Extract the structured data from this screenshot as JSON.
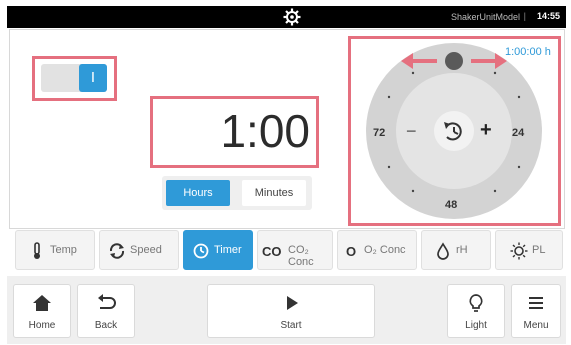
{
  "status_bar": {
    "model": "ShakerUnitModel",
    "separator": "|",
    "clock": "14:55",
    "settings_icon": "gear-icon"
  },
  "controls": {
    "toggle_label": "I",
    "toggle_on": true,
    "time_value": "1:00",
    "units": [
      {
        "label": "Hours",
        "selected": true
      },
      {
        "label": "Minutes",
        "selected": false
      }
    ]
  },
  "dial": {
    "readout": "1:00:00 h",
    "minus_symbol": "−",
    "plus_symbol": "+",
    "labels": {
      "left": "72",
      "right": "24",
      "bottom": "48"
    },
    "center_icon": "timer-reset-icon"
  },
  "tabs": [
    {
      "label": "Temp",
      "icon": "thermometer-icon",
      "active": false
    },
    {
      "label": "Speed",
      "icon": "rotate-icon",
      "active": false
    },
    {
      "label": "Timer",
      "icon": "clock-icon",
      "active": true
    },
    {
      "label": "CO₂ Conc",
      "icon": "co2-icon",
      "active": false
    },
    {
      "label": "O₂ Conc",
      "icon": "o2-icon",
      "active": false
    },
    {
      "label": "rH",
      "icon": "droplet-icon",
      "active": false
    },
    {
      "label": "PL",
      "icon": "sun-icon",
      "active": false
    }
  ],
  "bottom_bar": {
    "home": "Home",
    "back": "Back",
    "start": "Start",
    "light": "Light",
    "menu": "Menu"
  },
  "colors": {
    "accent": "#2f9ad8",
    "highlight": "#e5707f"
  }
}
